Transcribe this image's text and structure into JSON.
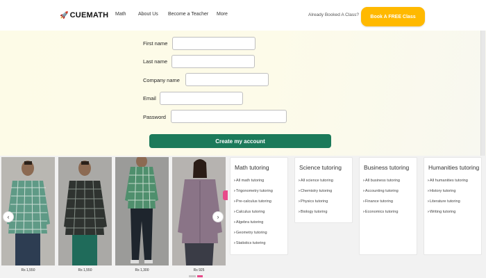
{
  "nav": {
    "logo": "CUEMATH",
    "links": [
      "Math",
      "About Us",
      "Become a Teacher",
      "More"
    ],
    "booked_text": "Already Booked A Class?",
    "cta": "Book A FREE Class"
  },
  "form": {
    "fields": [
      {
        "label": "First name",
        "value": ""
      },
      {
        "label": "Last name",
        "value": ""
      },
      {
        "label": "Company name",
        "value": ""
      },
      {
        "label": "Email",
        "value": ""
      },
      {
        "label": "Password",
        "value": ""
      }
    ],
    "submit": "Create my account"
  },
  "products": {
    "prices": [
      "Rs 1,550",
      "Rs 1,550",
      "Rs 1,300",
      "Rs 925"
    ],
    "prev_icon": "chevron-left-icon",
    "next_icon": "chevron-right-icon"
  },
  "tutoring": [
    {
      "title": "Math tutoring",
      "items": [
        "All math tutoring",
        "Trigonometry tutoring",
        "Pre-calculus tutoring",
        "Calculus tutoring",
        "Algebra tutoring",
        "Geometry tutoring",
        "Statistics tutoring"
      ]
    },
    {
      "title": "Science tutoring",
      "items": [
        "All science tutoring",
        "Chemistry tutoring",
        "Physics tutoring",
        "Biology tutoring"
      ]
    },
    {
      "title": "Business tutoring",
      "items": [
        "All business tutoring",
        "Accounting tutoring",
        "Finance tutoring",
        "Economics tutoring"
      ]
    },
    {
      "title": "Humanities tutoring",
      "items": [
        "All humanities tutoring",
        "History tutoring",
        "Literature tutoring",
        "Writing tutoring"
      ]
    }
  ],
  "colors": {
    "cta": "#ffb900",
    "submit": "#1c7a5a",
    "form_bg": "#fdfbe7",
    "accent_pink": "#e84a8a"
  }
}
